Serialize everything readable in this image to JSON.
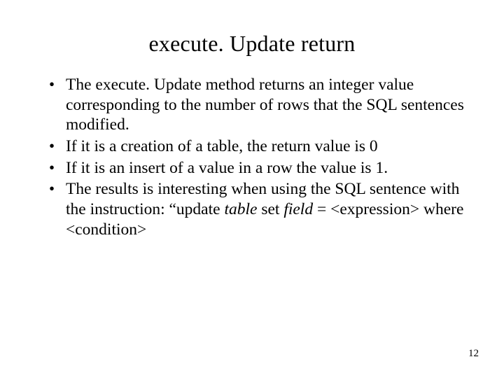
{
  "slide": {
    "title": "execute. Update return",
    "bullets": [
      {
        "plain": "The execute. Update method returns an integer value corresponding to the number of rows that the SQL sentences modified."
      },
      {
        "plain": "If it is a creation of a table, the return value is 0"
      },
      {
        "plain": "If it is an insert of a value in a row the value is 1."
      },
      {
        "prefix": "The results is interesting when using the SQL sentence with the instruction: “update ",
        "ital1": "table",
        "mid": " set ",
        "ital2": "field",
        "suffix": " = <expression> where <condition>"
      }
    ],
    "page_number": "12"
  }
}
